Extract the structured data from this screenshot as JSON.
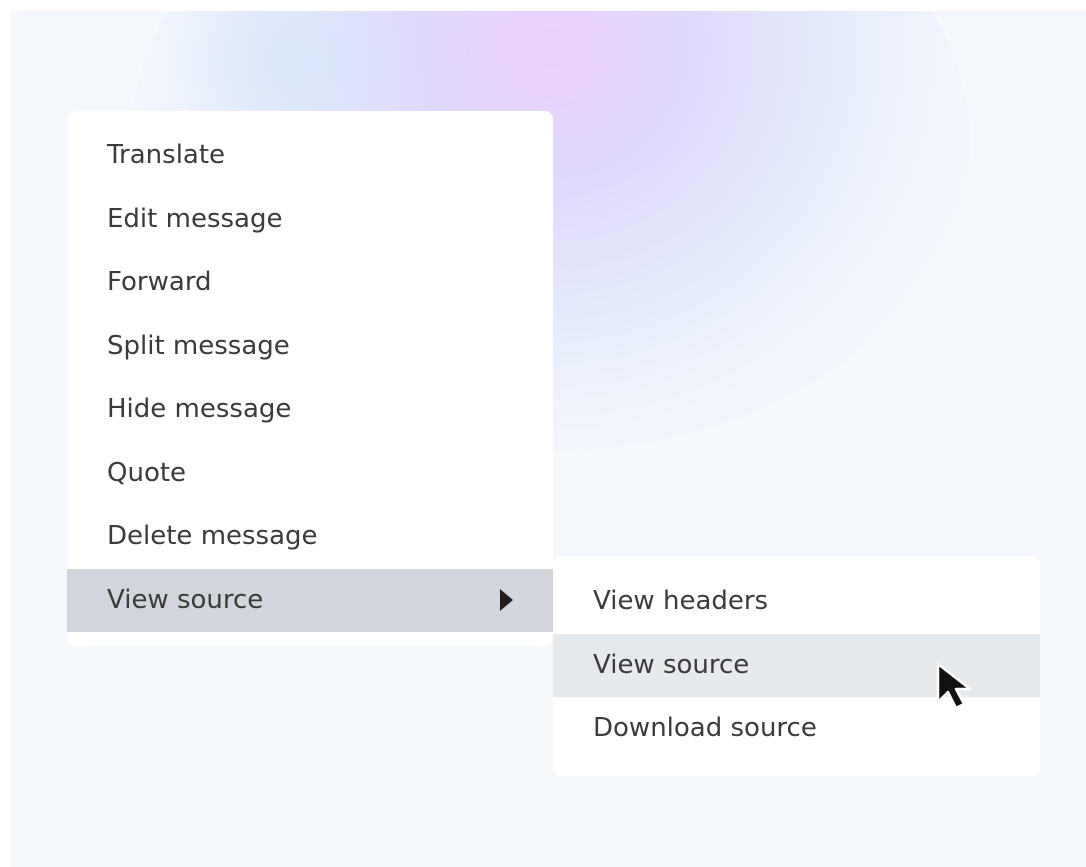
{
  "context_menu": {
    "items": [
      {
        "label": "Translate"
      },
      {
        "label": "Edit message"
      },
      {
        "label": "Forward"
      },
      {
        "label": "Split message"
      },
      {
        "label": "Hide message"
      },
      {
        "label": "Quote"
      },
      {
        "label": "Delete message"
      },
      {
        "label": "View source",
        "has_submenu": true,
        "active": true
      }
    ]
  },
  "submenu": {
    "items": [
      {
        "label": "View headers"
      },
      {
        "label": "View source",
        "hovered": true
      },
      {
        "label": "Download source"
      }
    ]
  },
  "icons": {
    "submenu_arrow": "chevron-right-icon",
    "cursor": "mouse-pointer-icon"
  },
  "colors": {
    "background": "#f4f8fc",
    "menu_background": "#ffffff",
    "active_item": "#d1d6dc",
    "hovered_item": "#e6e9ed",
    "text": "#3b3b3b"
  }
}
